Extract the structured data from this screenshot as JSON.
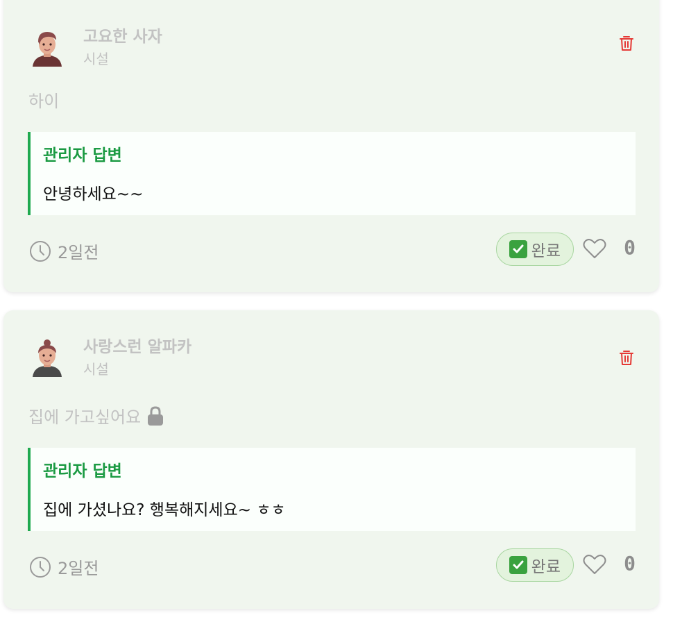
{
  "posts": [
    {
      "author": "고요한 사자",
      "category": "시설",
      "question": "하이",
      "locked": false,
      "reply_title": "관리자 답변",
      "reply_text": "안녕하세요~~",
      "time": "2일전",
      "status": "완료",
      "likes": "0"
    },
    {
      "author": "사랑스런 알파카",
      "category": "시설",
      "question": "집에 가고싶어요",
      "locked": true,
      "reply_title": "관리자 답변",
      "reply_text": "집에 가셨나요? 행복해지세요~ ㅎㅎ",
      "time": "2일전",
      "status": "완료",
      "likes": "0"
    }
  ],
  "icons": {
    "delete": "trash-icon",
    "time": "clock-icon",
    "status": "check-box-icon",
    "like": "heart-icon",
    "private": "lock-icon"
  },
  "colors": {
    "card_bg": "#f0f6ee",
    "accent_green": "#1a9a42",
    "delete_red": "#e53935",
    "muted_text": "#c2c2c2"
  }
}
